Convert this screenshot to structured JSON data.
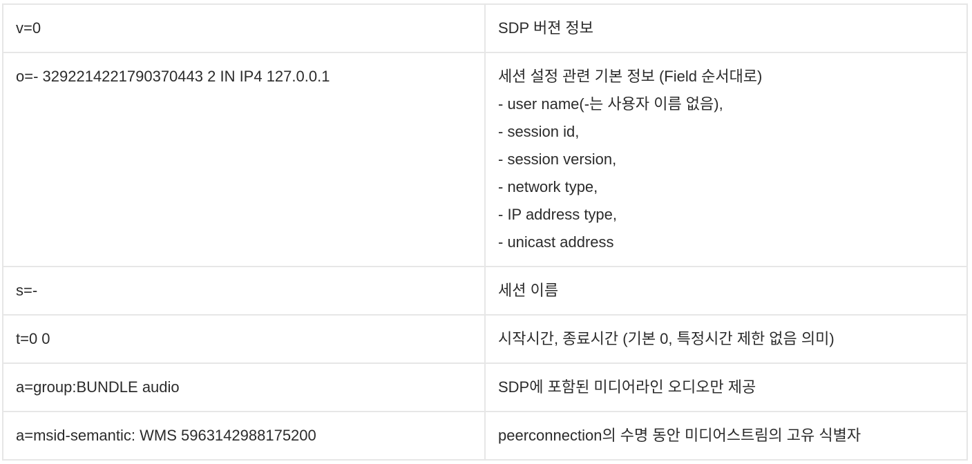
{
  "rows": [
    {
      "key": "v=0",
      "desc": [
        "SDP 버젼 정보"
      ]
    },
    {
      "key": "o=- 3292214221790370443 2 IN IP4 127.0.0.1",
      "desc": [
        "세션 설정 관련 기본 정보 (Field 순서대로)",
        "- user name(-는 사용자 이름 없음),",
        "- session id,",
        "- session version,",
        "- network type,",
        "- IP address type,",
        "- unicast address"
      ]
    },
    {
      "key": "s=-",
      "desc": [
        "세션 이름"
      ]
    },
    {
      "key": "t=0 0",
      "desc": [
        "시작시간, 종료시간 (기본 0, 특정시간 제한 없음 의미)"
      ]
    },
    {
      "key": "a=group:BUNDLE audio",
      "desc": [
        "SDP에 포함된 미디어라인 오디오만 제공"
      ]
    },
    {
      "key": "a=msid-semantic: WMS 5963142988175200",
      "desc": [
        "peerconnection의 수명 동안 미디어스트림의 고유 식별자"
      ]
    }
  ]
}
